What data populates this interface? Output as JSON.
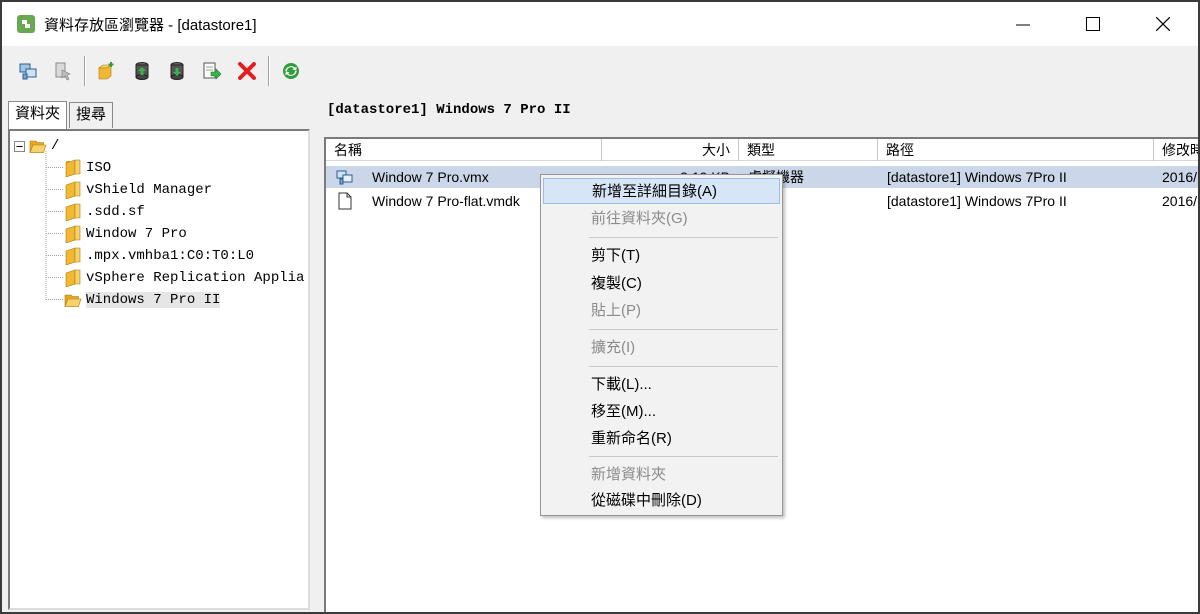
{
  "window": {
    "title": "資料存放區瀏覽器 - [datastore1]"
  },
  "left": {
    "tabs": [
      {
        "label": "資料夾"
      },
      {
        "label": "搜尋"
      }
    ],
    "tree": {
      "root": "/",
      "items": [
        {
          "label": "ISO"
        },
        {
          "label": "vShield Manager"
        },
        {
          "label": ".sdd.sf"
        },
        {
          "label": "Window 7 Pro"
        },
        {
          "label": ".mpx.vmhba1:C0:T0:L0"
        },
        {
          "label": "vSphere Replication Applia"
        },
        {
          "label": "Windows 7 Pro II"
        }
      ]
    }
  },
  "right": {
    "path": "[datastore1] Windows 7 Pro II",
    "columns": {
      "name": "名稱",
      "size": "大小",
      "type": "類型",
      "path": "路徑",
      "modified": "修改時"
    },
    "rows": [
      {
        "name": "Window 7 Pro.vmx",
        "size": "3.19 KB",
        "type": "虛擬機器",
        "path": "[datastore1] Windows 7Pro II",
        "modified": "2016/"
      },
      {
        "name": "Window 7 Pro-flat.vmdk",
        "size": "",
        "type": "",
        "path": "[datastore1] Windows 7Pro II",
        "modified": "2016/"
      }
    ]
  },
  "context_menu": {
    "items": [
      {
        "label": "新增至詳細目錄(A)",
        "state": "highlight"
      },
      {
        "label": "前往資料夾(G)",
        "state": "disabled"
      },
      {
        "label": "剪下(T)",
        "state": "enabled"
      },
      {
        "label": "複製(C)",
        "state": "enabled"
      },
      {
        "label": "貼上(P)",
        "state": "disabled"
      },
      {
        "label": "擴充(I)",
        "state": "disabled"
      },
      {
        "label": "下載(L)...",
        "state": "enabled"
      },
      {
        "label": "移至(M)...",
        "state": "enabled"
      },
      {
        "label": "重新命名(R)",
        "state": "enabled"
      },
      {
        "label": "新增資料夾",
        "state": "disabled"
      },
      {
        "label": "從磁碟中刪除(D)",
        "state": "enabled"
      }
    ]
  },
  "colors": {
    "selection": "#cbd7e8",
    "menu_highlight": "#d7e6f7",
    "folder": "#f2b733",
    "delete": "#e02020",
    "refresh": "#2f9e3a"
  }
}
